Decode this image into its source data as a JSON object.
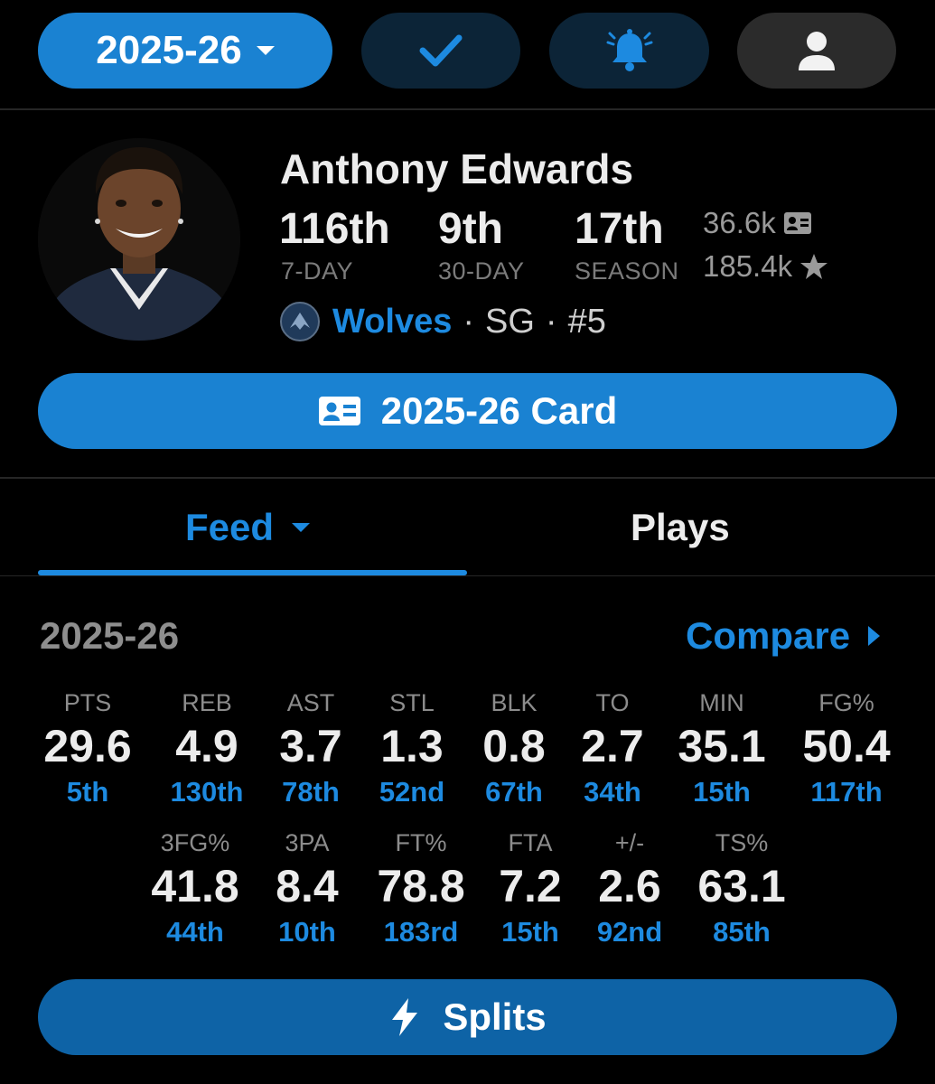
{
  "topbar": {
    "season_label": "2025-26",
    "icons": {
      "check": "check-icon",
      "bell": "bell-ring-icon",
      "user": "user-icon"
    }
  },
  "player": {
    "name": "Anthony Edwards",
    "ranks": [
      {
        "value": "116th",
        "label": "7-DAY"
      },
      {
        "value": "9th",
        "label": "30-DAY"
      },
      {
        "value": "17th",
        "label": "SEASON"
      }
    ],
    "card_count": "36.6k",
    "star_count": "185.4k",
    "team": "Wolves",
    "position": "SG",
    "number": "#5",
    "sep": "·"
  },
  "card_button": {
    "label": "2025-26 Card",
    "icon": "id-card-icon"
  },
  "tabs": {
    "feed": "Feed",
    "plays": "Plays"
  },
  "stats_section": {
    "season": "2025-26",
    "compare": "Compare",
    "row1": [
      {
        "label": "PTS",
        "value": "29.6",
        "rank": "5th"
      },
      {
        "label": "REB",
        "value": "4.9",
        "rank": "130th"
      },
      {
        "label": "AST",
        "value": "3.7",
        "rank": "78th"
      },
      {
        "label": "STL",
        "value": "1.3",
        "rank": "52nd"
      },
      {
        "label": "BLK",
        "value": "0.8",
        "rank": "67th"
      },
      {
        "label": "TO",
        "value": "2.7",
        "rank": "34th"
      },
      {
        "label": "MIN",
        "value": "35.1",
        "rank": "15th"
      },
      {
        "label": "FG%",
        "value": "50.4",
        "rank": "117th"
      }
    ],
    "row2": [
      {
        "label": "3FG%",
        "value": "41.8",
        "rank": "44th"
      },
      {
        "label": "3PA",
        "value": "8.4",
        "rank": "10th"
      },
      {
        "label": "FT%",
        "value": "78.8",
        "rank": "183rd"
      },
      {
        "label": "FTA",
        "value": "7.2",
        "rank": "15th"
      },
      {
        "label": "+/-",
        "value": "2.6",
        "rank": "92nd"
      },
      {
        "label": "TS%",
        "value": "63.1",
        "rank": "85th"
      }
    ]
  },
  "splits_button": {
    "label": "Splits",
    "icon": "lightning-icon"
  },
  "colors": {
    "accent": "#1d8ae0",
    "button": "#1a82d2",
    "splits": "#0e63a6",
    "background": "#000000"
  }
}
